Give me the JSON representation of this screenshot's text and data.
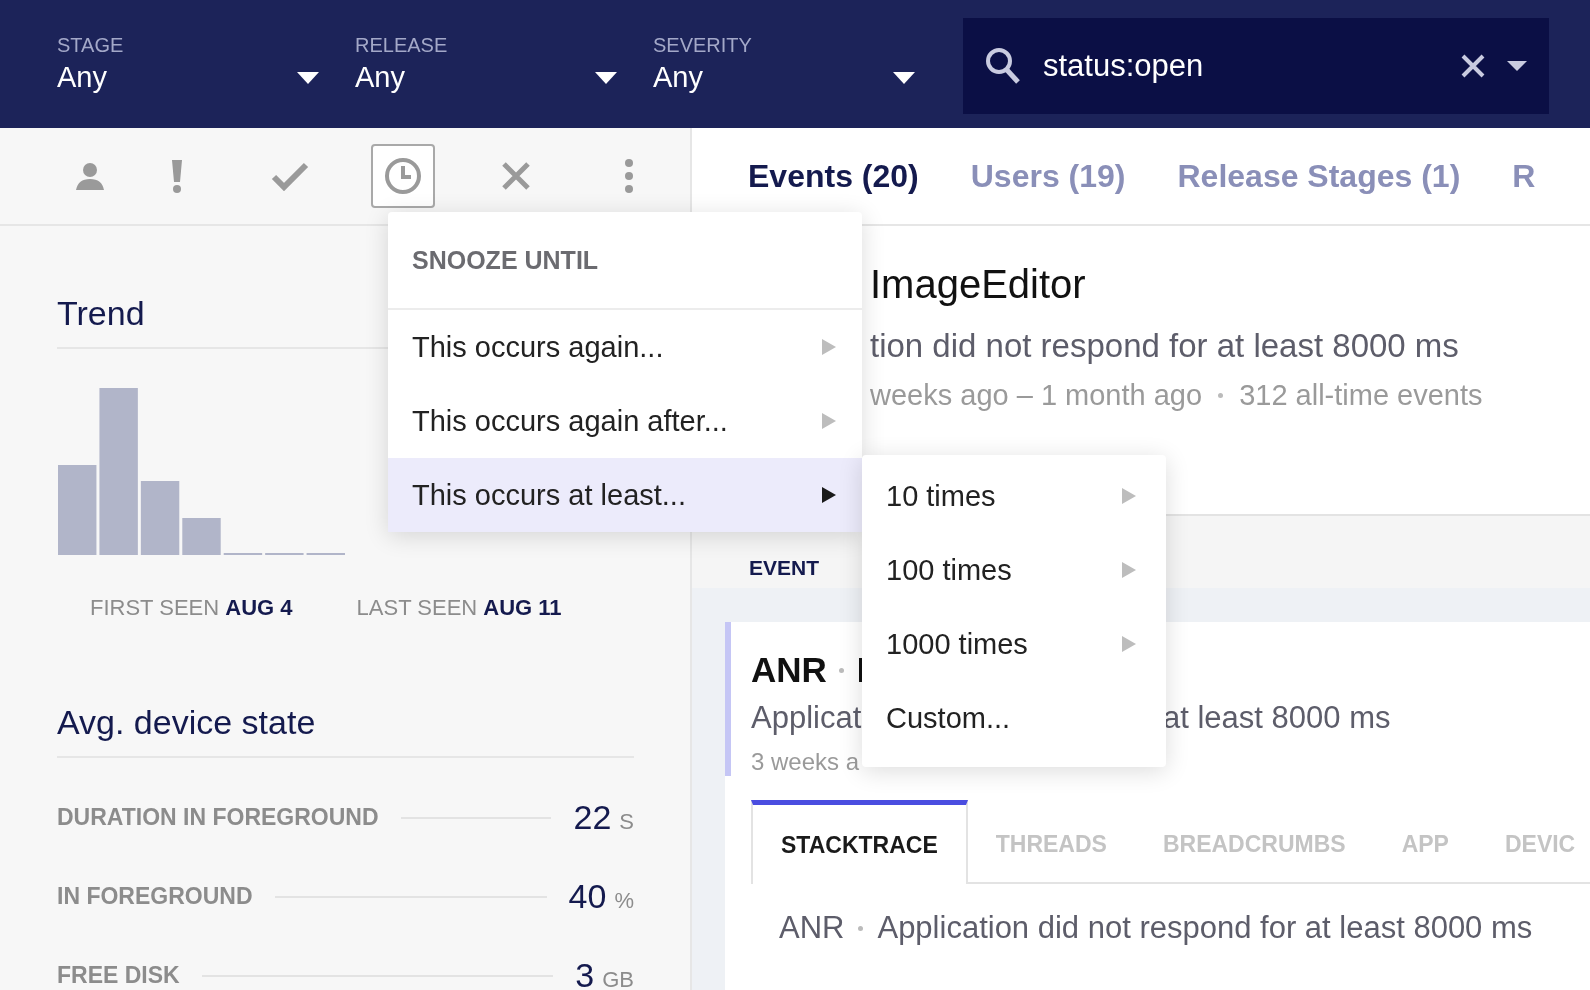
{
  "filters": [
    {
      "label": "STAGE",
      "value": "Any"
    },
    {
      "label": "RELEASE",
      "value": "Any"
    },
    {
      "label": "SEVERITY",
      "value": "Any"
    }
  ],
  "search": {
    "value": "status:open"
  },
  "toolbar": [
    {
      "kind": "assign",
      "selected": false
    },
    {
      "kind": "priority",
      "selected": false
    },
    {
      "kind": "fix",
      "selected": false
    },
    {
      "kind": "snooze",
      "selected": true
    },
    {
      "kind": "ignore",
      "selected": false
    },
    {
      "kind": "more",
      "selected": false
    }
  ],
  "tabs": [
    {
      "label": "Events (20)",
      "selected": true
    },
    {
      "label": "Users (19)",
      "selected": false
    },
    {
      "label": "Release Stages (1)",
      "selected": false
    },
    {
      "label": "R",
      "selected": false
    }
  ],
  "trend": {
    "title": "Trend",
    "first_seen_label": "FIRST SEEN",
    "first_seen": "AUG 4",
    "last_seen_label": "LAST SEEN",
    "last_seen": "AUG 11"
  },
  "device_state": {
    "title": "Avg. device state",
    "stats": [
      {
        "label": "DURATION IN FOREGROUND",
        "value": "22",
        "unit": "S"
      },
      {
        "label": "IN FOREGROUND",
        "value": "40",
        "unit": "%"
      },
      {
        "label": "FREE DISK",
        "value": "3",
        "unit": "GB"
      }
    ]
  },
  "error_summary": {
    "title": "ImageEditor",
    "message": "tion did not respond for at least 8000 ms",
    "seen": "weeks ago – 1 month ago",
    "events": "312 all-time events",
    "section_tab": "EVENT"
  },
  "event": {
    "error_class": "ANR",
    "title_start": "I",
    "message_start": "Applicat",
    "message_end": "at least 8000 ms",
    "time_start": "3 weeks a",
    "tabs": [
      {
        "label": "STACKTRACE",
        "selected": true
      },
      {
        "label": "THREADS",
        "selected": false
      },
      {
        "label": "BREADCRUMBS",
        "selected": false
      },
      {
        "label": "APP",
        "selected": false
      },
      {
        "label": "DEVIC",
        "selected": false
      }
    ],
    "exception_class": "ANR",
    "exception_message": "Application did not respond for at least 8000 ms"
  },
  "snooze_menu": {
    "title": "SNOOZE UNTIL",
    "items": [
      {
        "label": "This occurs again...",
        "selected": false
      },
      {
        "label": "This occurs again after...",
        "selected": false
      },
      {
        "label": "This occurs at least...",
        "selected": true
      }
    ]
  },
  "submenu": {
    "items": [
      {
        "label": "10 times",
        "kind": "submenu"
      },
      {
        "label": "100 times",
        "kind": "submenu"
      },
      {
        "label": "1000 times",
        "kind": "submenu"
      },
      {
        "label": "Custom...",
        "kind": "action"
      }
    ]
  }
}
